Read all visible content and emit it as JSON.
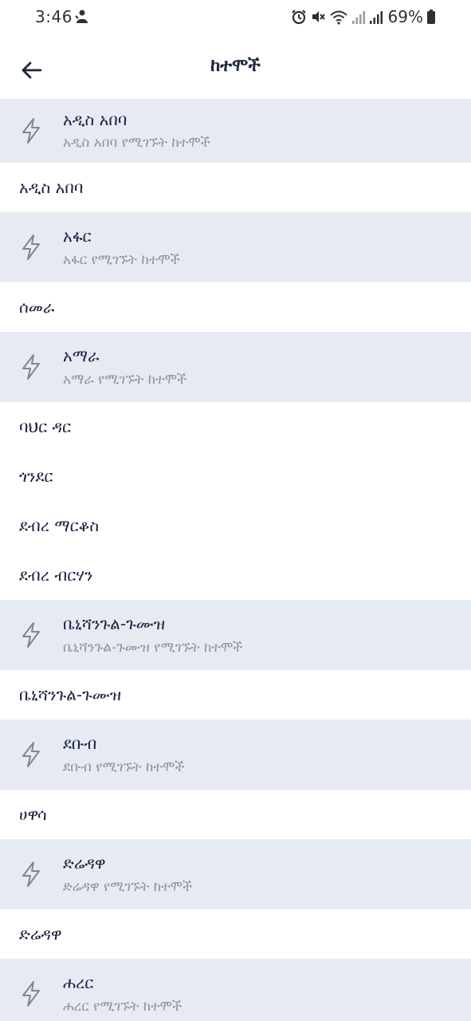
{
  "status_bar": {
    "time": "3:46",
    "battery": "69%"
  },
  "app_bar": {
    "title": "ከተሞች"
  },
  "colors": {
    "region_bg": "#e6ebf3",
    "text": "#1c2540",
    "subtext": "#8a93a6",
    "icon": "#7d8699"
  },
  "items": [
    {
      "type": "region",
      "title": "አዲስ አበባ",
      "subtitle": "አዲስ አበባ የሚገኙት ከተሞች",
      "icon": "lightning-icon"
    },
    {
      "type": "city",
      "label": "አዲስ አበባ"
    },
    {
      "type": "region",
      "title": "አፋር",
      "subtitle": "አፋር የሚገኙት ከተሞች",
      "icon": "lightning-icon"
    },
    {
      "type": "city",
      "label": "ሰመራ"
    },
    {
      "type": "region",
      "title": "አማራ",
      "subtitle": "አማራ የሚገኙት ከተሞች",
      "icon": "lightning-icon"
    },
    {
      "type": "city",
      "label": "ባህር ዳር"
    },
    {
      "type": "city",
      "label": "ጎንደር"
    },
    {
      "type": "city",
      "label": "ደብረ ማርቆስ"
    },
    {
      "type": "city",
      "label": "ደብረ ብርሃን"
    },
    {
      "type": "region",
      "title": "ቤኒሻንጉል-ጉሙዝ",
      "subtitle": "ቤኒሻንጉል-ጉሙዝ የሚገኙት ከተሞች",
      "icon": "lightning-icon"
    },
    {
      "type": "city",
      "label": "ቤኒሻንጉል-ጉሙዝ"
    },
    {
      "type": "region",
      "title": "ደቡብ",
      "subtitle": "ደቡብ የሚገኙት ከተሞች",
      "icon": "lightning-icon"
    },
    {
      "type": "city",
      "label": "ሀዋሳ"
    },
    {
      "type": "region",
      "title": "ድሬዳዋ",
      "subtitle": "ድሬዳዋ የሚገኙት ከተሞች",
      "icon": "lightning-icon"
    },
    {
      "type": "city",
      "label": "ድሬዳዋ"
    },
    {
      "type": "region",
      "title": "ሐረር",
      "subtitle": "ሐረር የሚገኙት ከተሞች",
      "icon": "lightning-icon"
    }
  ]
}
